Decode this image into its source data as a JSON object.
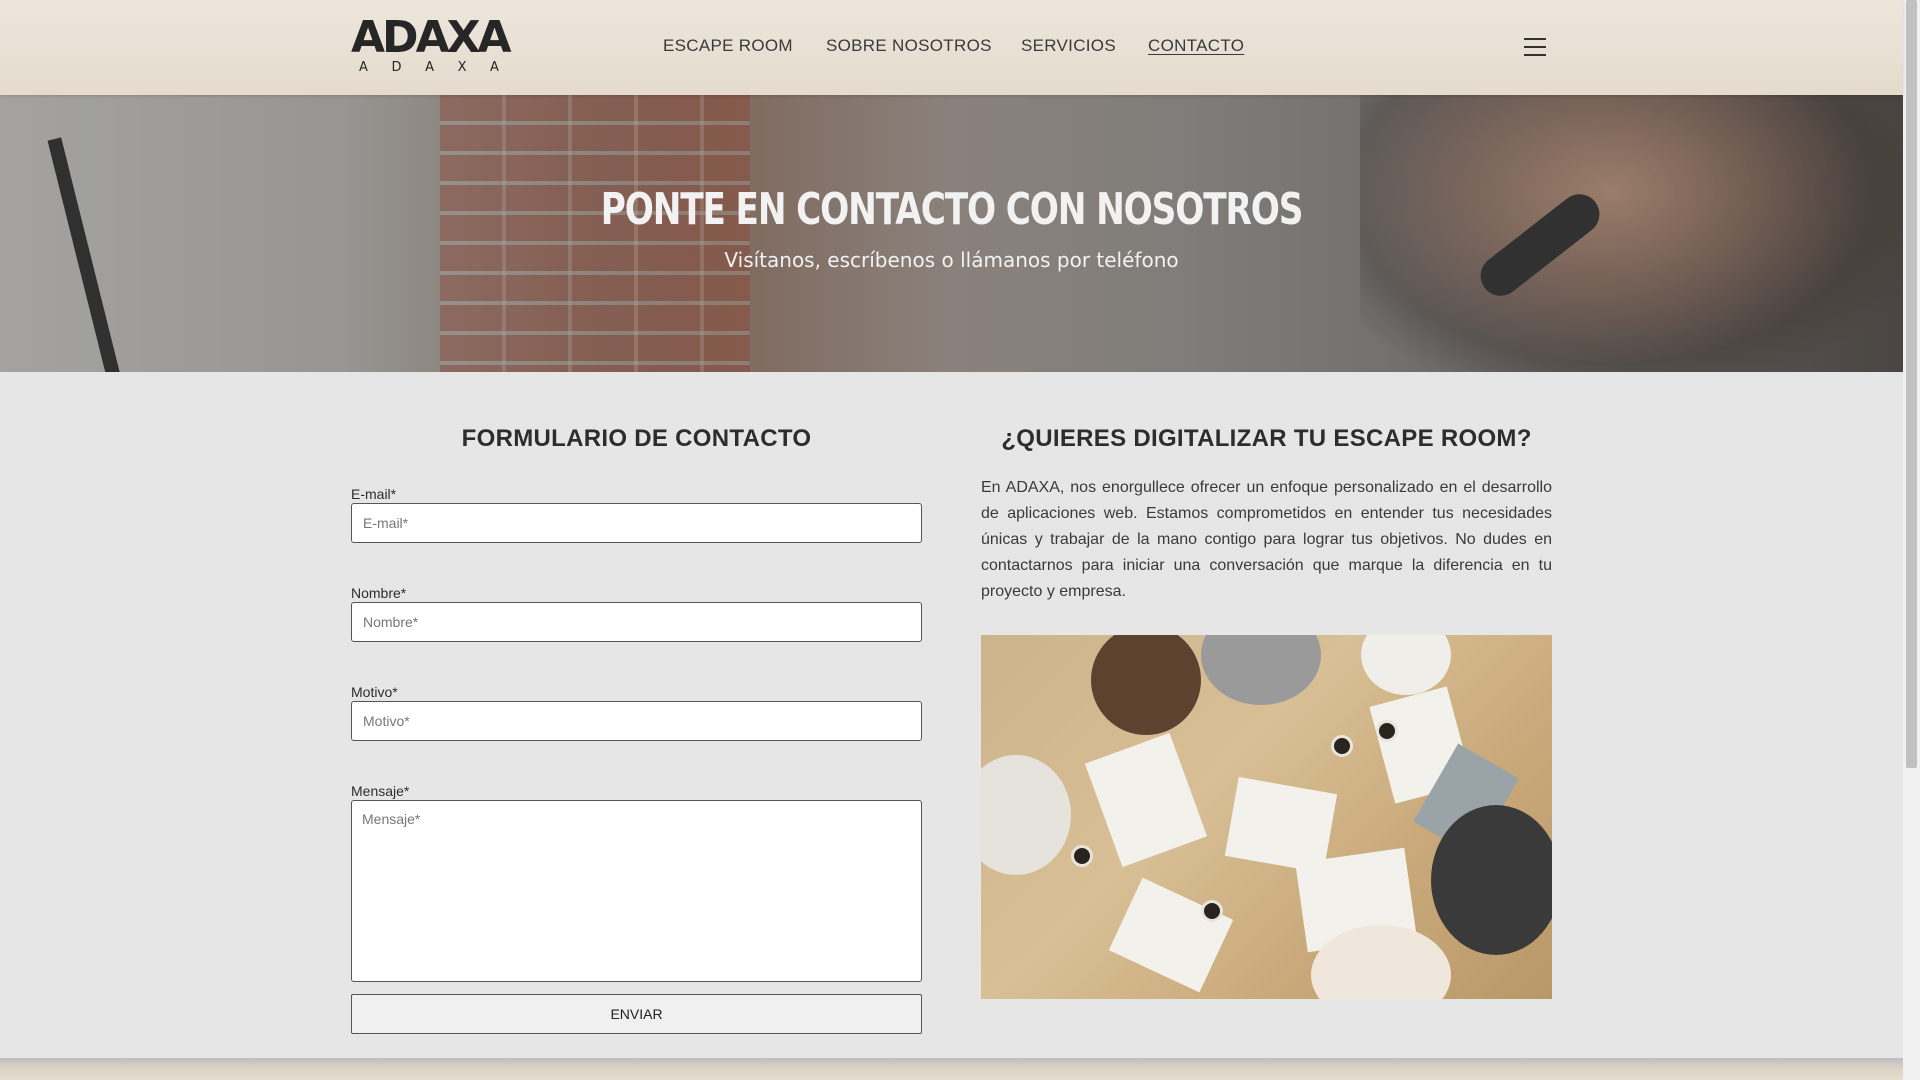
{
  "brand": {
    "logo_text": "ADAXA",
    "logo_letters": [
      "A",
      "D",
      "A",
      "X",
      "A"
    ]
  },
  "nav": {
    "items": [
      {
        "label": "ESCAPE ROOM"
      },
      {
        "label": "SOBRE NOSOTROS"
      },
      {
        "label": "SERVICIOS"
      },
      {
        "label": "CONTACTO",
        "active": true
      }
    ],
    "menu_icon": "hamburger-icon"
  },
  "hero": {
    "title": "PONTE EN CONTACTO CON NOSOTROS",
    "subtitle": "Visítanos, escríbenos o llámanos por teléfono"
  },
  "form": {
    "heading": "FORMULARIO DE CONTACTO",
    "fields": [
      {
        "label": "E-mail*",
        "placeholder": "E-mail*",
        "value": ""
      },
      {
        "label": "Nombre*",
        "placeholder": "Nombre*",
        "value": ""
      },
      {
        "label": "Motivo*",
        "placeholder": "Motivo*",
        "value": ""
      },
      {
        "label": "Mensaje*",
        "placeholder": "Mensaje*",
        "value": ""
      }
    ],
    "submit_label": "ENVIAR"
  },
  "info": {
    "heading": "¿QUIERES DIGITALIZAR TU ESCAPE ROOM?",
    "paragraph": "En ADAXA, nos enorgullece ofrecer un enfoque personalizado en el desarrollo de aplicaciones web. Estamos comprometidos en entender tus necesidades únicas y trabajar de la mano contigo para lograr tus objetivos. No dudes en contactarnos para iniciar una conversación que marque la diferencia en tu proyecto y empresa."
  },
  "colors": {
    "header_bg": "#e8e0d4",
    "page_bg": "#e6e6e6",
    "text": "#2d2d2d"
  }
}
